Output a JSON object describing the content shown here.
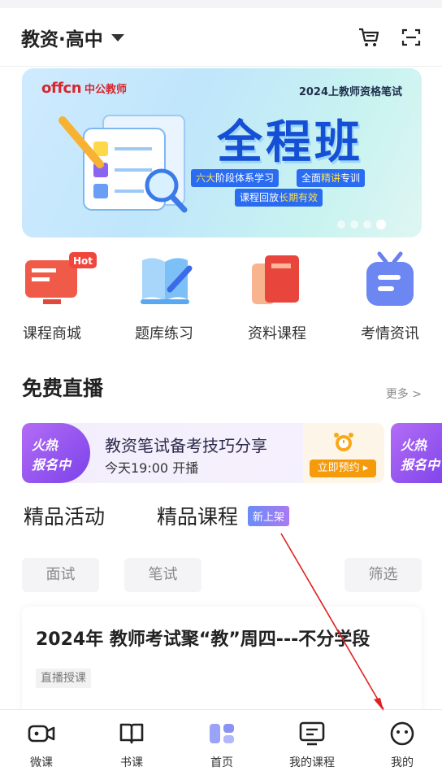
{
  "header": {
    "title": "教资·高中",
    "cart_icon": "cart-icon",
    "scan_icon": "scan-icon"
  },
  "banner": {
    "brand_logo": "offcn",
    "brand_name": "中公教师",
    "exam": "2024上教师资格笔试",
    "headline": "全程班",
    "tag1_a": "六大",
    "tag1_b": "阶段体系学习",
    "tag2_a": "全面",
    "tag2_b": "精讲",
    "tag2_c": "专训",
    "tag3_a": "课程回放",
    "tag3_b": "长期有效",
    "active_slide": 4,
    "slide_count": 4
  },
  "quick_links": [
    {
      "label": "课程商城",
      "badge": "Hot",
      "icon": "monitor-icon"
    },
    {
      "label": "题库练习",
      "icon": "book-pen-icon"
    },
    {
      "label": "资料课程",
      "icon": "notebook-icon"
    },
    {
      "label": "考情资讯",
      "icon": "tv-icon"
    }
  ],
  "live": {
    "title": "免费直播",
    "more": "更多 >",
    "card": {
      "badge_line1": "火热",
      "badge_line2": "报名中",
      "title": "教资笔试备考技巧分享",
      "time": "今天19:00 开播",
      "button": "立即预约 ▸"
    },
    "card2": {
      "badge_line1": "火热",
      "badge_line2": "报名中"
    }
  },
  "tabs": {
    "active": "精品活动",
    "other": "精品课程",
    "new_badge": "新上架"
  },
  "filters": {
    "interview": "面试",
    "written": "笔试",
    "filter": "筛选"
  },
  "course_card": {
    "title": "2024年 教师考试聚“教”周四---不分学段",
    "tag": "直播授课"
  },
  "tabbar": [
    {
      "label": "微课",
      "icon": "video-camera-icon"
    },
    {
      "label": "书课",
      "icon": "open-book-icon"
    },
    {
      "label": "首页",
      "icon": "home-grid-icon"
    },
    {
      "label": "我的课程",
      "icon": "screen-icon"
    },
    {
      "label": "我的",
      "icon": "smiley-icon"
    }
  ],
  "colors": {
    "brand_blue": "#1550d4",
    "purple": "#8a4cf0",
    "orange": "#f59a0b",
    "annotation_red": "#e02020"
  }
}
